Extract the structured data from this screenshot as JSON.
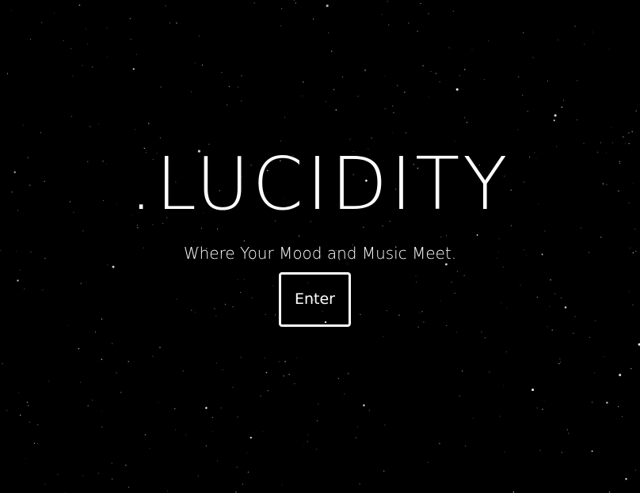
{
  "app": {
    "title": ".LUCIDITY",
    "tagline": "Where Your Mood and Music Meet.",
    "enter_label": "Enter"
  },
  "colors": {
    "background": "#000000",
    "text": "#ffffff",
    "star": "#ffffff"
  }
}
